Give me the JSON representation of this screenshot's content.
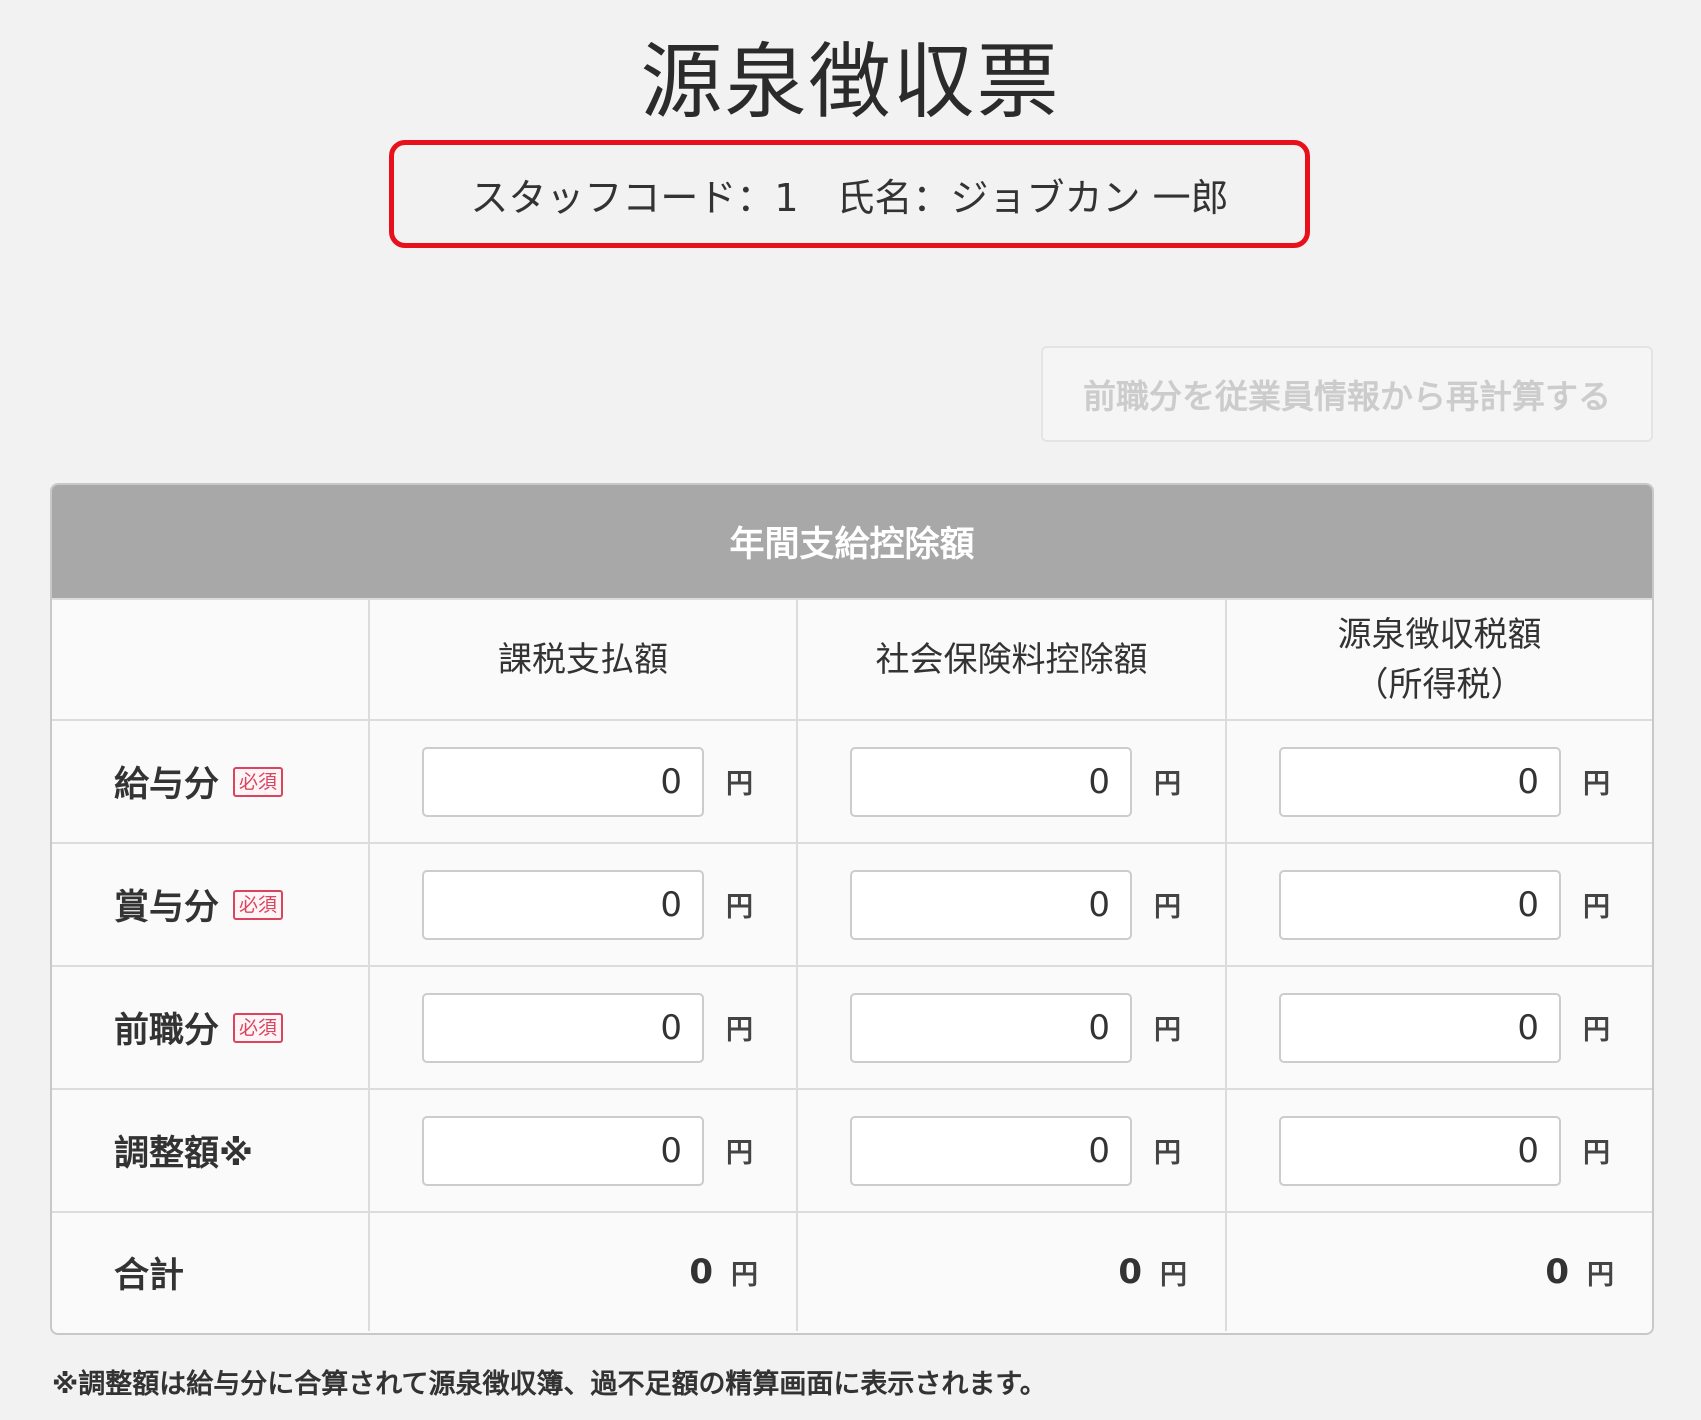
{
  "page": {
    "title": "源泉徴収票",
    "staff_info": "スタッフコード：1　氏名：ジョブカン 一郎"
  },
  "toolbar": {
    "recalc_label": "前職分を従業員情報から再計算する"
  },
  "table": {
    "header": "年間支給控除額",
    "columns": [
      {
        "line1": "課税支払額",
        "line2": ""
      },
      {
        "line1": "社会保険料控除額",
        "line2": ""
      },
      {
        "line1": "源泉徴収税額",
        "line2": "（所得税）"
      }
    ],
    "required_label": "必須",
    "unit": "円",
    "rows": [
      {
        "label": "給与分",
        "required": true,
        "values": [
          "0",
          "0",
          "0"
        ]
      },
      {
        "label": "賞与分",
        "required": true,
        "values": [
          "0",
          "0",
          "0"
        ]
      },
      {
        "label": "前職分",
        "required": true,
        "values": [
          "0",
          "0",
          "0"
        ]
      },
      {
        "label": "調整額※",
        "required": false,
        "values": [
          "0",
          "0",
          "0"
        ]
      }
    ],
    "total": {
      "label": "合計",
      "values": [
        "0",
        "0",
        "0"
      ]
    }
  },
  "footnote": "※調整額は給与分に合算されて源泉徴収簿、過不足額の精算画面に表示されます。",
  "colors": {
    "highlight_border": "#e8111b",
    "table_header_bg": "#a8a8a8",
    "required_badge": "#d9455f"
  }
}
